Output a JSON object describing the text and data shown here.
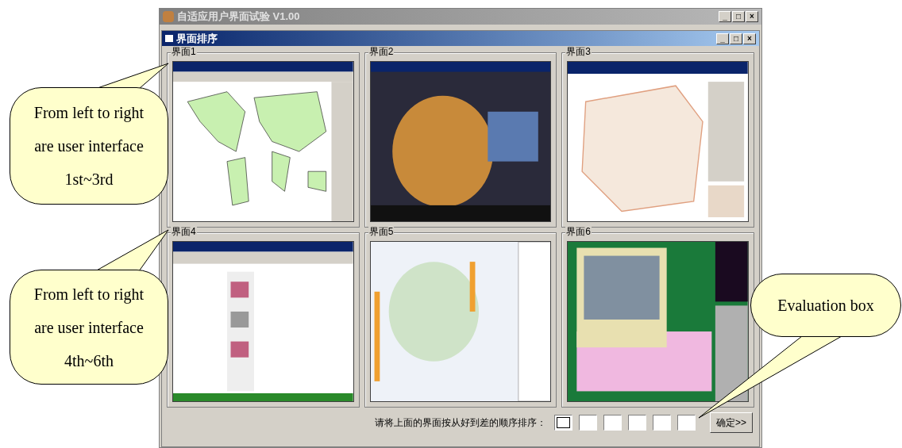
{
  "window": {
    "title": "自适应用户界面试验 V1.00",
    "buttons": [
      "_",
      "□",
      "×"
    ]
  },
  "child_window": {
    "title": "界面排序",
    "buttons": [
      "_",
      "□",
      "×"
    ]
  },
  "panels": [
    {
      "label": "界面1",
      "kind": "world-map"
    },
    {
      "label": "界面2",
      "kind": "globe"
    },
    {
      "label": "界面3",
      "kind": "city-map"
    },
    {
      "label": "界面4",
      "kind": "document"
    },
    {
      "label": "界面5",
      "kind": "terrain-map"
    },
    {
      "label": "界面6",
      "kind": "video-map"
    }
  ],
  "ranking": {
    "prompt": "请将上面的界面按从好到差的顺序排序：",
    "boxes": [
      {
        "focused": true
      },
      {
        "focused": false
      },
      {
        "focused": false
      },
      {
        "focused": false
      },
      {
        "focused": false
      },
      {
        "focused": false
      }
    ],
    "button": "确定>>"
  },
  "callouts": [
    {
      "text": "From left to right are user interface 1st~3rd"
    },
    {
      "text": "From left to right are user interface 4th~6th"
    },
    {
      "text": "Evaluation box"
    }
  ]
}
